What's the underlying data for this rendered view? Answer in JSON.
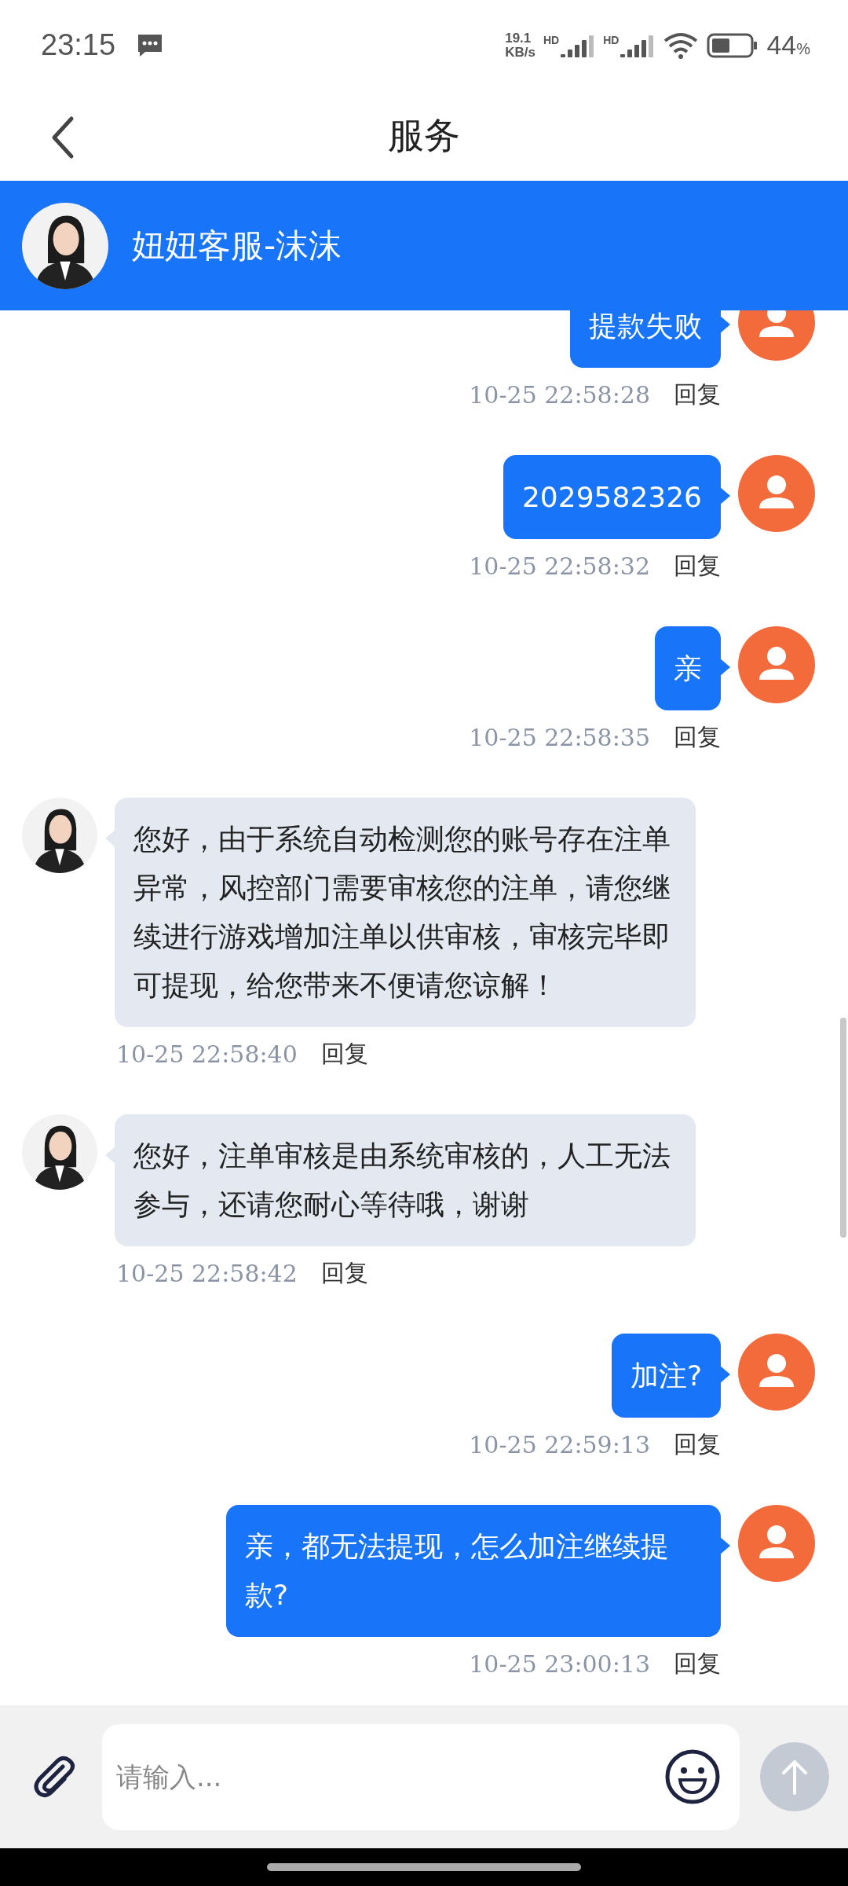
{
  "status_bar": {
    "time": "23:15",
    "speed_value": "19.1",
    "speed_unit": "KB/s",
    "signal_labels": [
      "HD",
      "HD"
    ],
    "battery_percent": "44",
    "percent_sign": "%"
  },
  "nav_bar": {
    "title": "服务"
  },
  "agent_header": {
    "name": "妞妞客服-沫沫"
  },
  "messages": [
    {
      "kind": "user",
      "text": "提款失败",
      "time": "10-25 22:58:28",
      "reply": "回复"
    },
    {
      "kind": "user",
      "text": "2029582326",
      "time": "10-25 22:58:32",
      "reply": "回复"
    },
    {
      "kind": "user",
      "text": "亲",
      "time": "10-25 22:58:35",
      "reply": "回复"
    },
    {
      "kind": "agent",
      "text": "您好，由于系统自动检测您的账号存在注单异常，风控部门需要审核您的注单，请您继续进行游戏增加注单以供审核，审核完毕即可提现，给您带来不便请您谅解！",
      "time": "10-25 22:58:40",
      "reply": "回复"
    },
    {
      "kind": "agent",
      "text": "您好，注单审核是由系统审核的，人工无法参与，还请您耐心等待哦，谢谢",
      "time": "10-25 22:58:42",
      "reply": "回复"
    },
    {
      "kind": "user",
      "text": "加注?",
      "time": "10-25 22:59:13",
      "reply": "回复"
    },
    {
      "kind": "user",
      "text": "亲，都无法提现，怎么加注继续提款?",
      "time": "10-25 23:00:13",
      "reply": "回复"
    }
  ],
  "composer": {
    "placeholder": "请输入..."
  }
}
